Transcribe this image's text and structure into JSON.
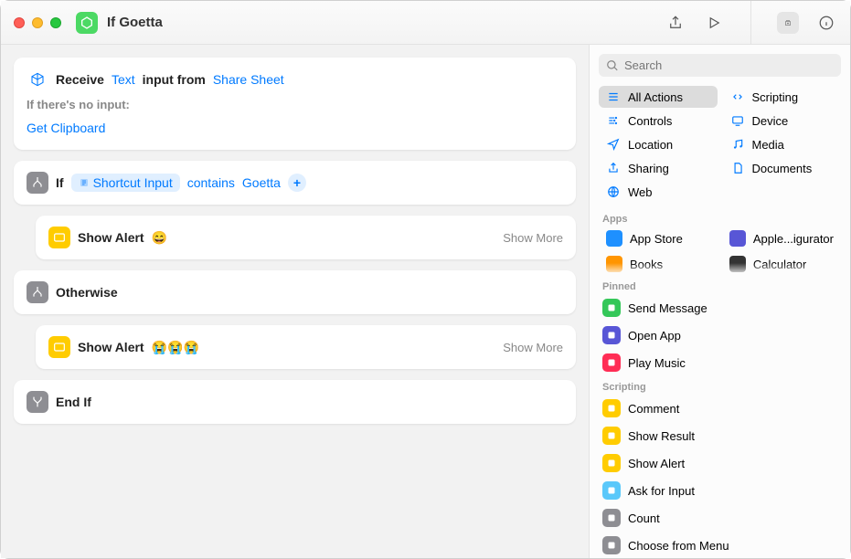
{
  "window": {
    "title": "If Goetta"
  },
  "toolbar": {
    "share": "Share",
    "run": "Run",
    "library": "Library",
    "info": "Info"
  },
  "editor": {
    "receive": {
      "label": "Receive",
      "type_token": "Text",
      "from_label": "input from",
      "source_token": "Share Sheet",
      "no_input_label": "If there's no input:",
      "fallback_token": "Get Clipboard"
    },
    "if_block": {
      "label": "If",
      "var_token": "Shortcut Input",
      "op_token": "contains",
      "value_token": "Goetta"
    },
    "alert1": {
      "label": "Show Alert",
      "emoji": "😄",
      "more": "Show More"
    },
    "otherwise": {
      "label": "Otherwise"
    },
    "alert2": {
      "label": "Show Alert",
      "emoji": "😭😭😭",
      "more": "Show More"
    },
    "endif": {
      "label": "End If"
    }
  },
  "sidebar": {
    "search_placeholder": "Search",
    "categories": [
      {
        "label": "All Actions",
        "selected": true
      },
      {
        "label": "Scripting"
      },
      {
        "label": "Controls"
      },
      {
        "label": "Device"
      },
      {
        "label": "Location"
      },
      {
        "label": "Media"
      },
      {
        "label": "Sharing"
      },
      {
        "label": "Documents"
      },
      {
        "label": "Web"
      }
    ],
    "apps_header": "Apps",
    "apps": [
      {
        "label": "App Store",
        "color": "#1e90ff"
      },
      {
        "label": "Apple...igurator",
        "color": "#5856d6"
      },
      {
        "label": "Books",
        "color": "#ff9500"
      },
      {
        "label": "Calculator",
        "color": "#333333"
      }
    ],
    "pinned_header": "Pinned",
    "pinned": [
      {
        "label": "Send Message",
        "color": "#34c759"
      },
      {
        "label": "Open App",
        "color": "#5856d6"
      },
      {
        "label": "Play Music",
        "color": "#ff2d55"
      }
    ],
    "scripting_header": "Scripting",
    "scripting": [
      {
        "label": "Comment",
        "color": "#ffcc00"
      },
      {
        "label": "Show Result",
        "color": "#ffcc00"
      },
      {
        "label": "Show Alert",
        "color": "#ffcc00"
      },
      {
        "label": "Ask for Input",
        "color": "#5ac8fa"
      },
      {
        "label": "Count",
        "color": "#8e8e93"
      },
      {
        "label": "Choose from Menu",
        "color": "#8e8e93"
      }
    ]
  }
}
